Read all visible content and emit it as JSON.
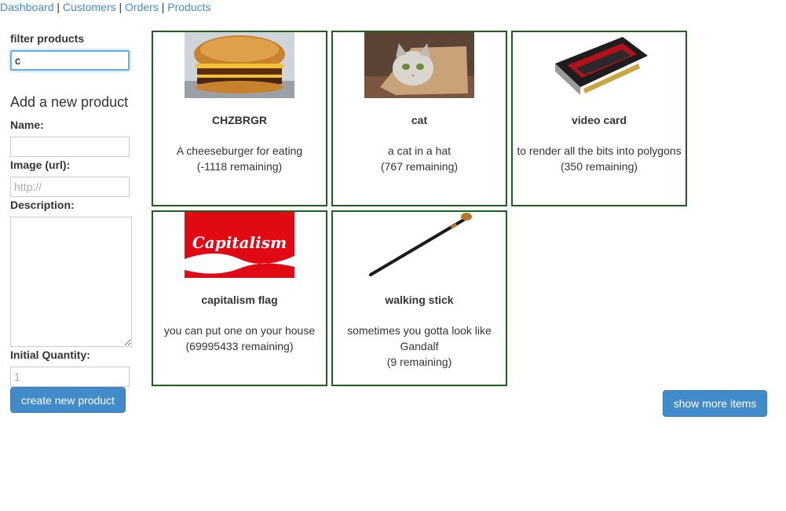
{
  "nav": {
    "links": [
      "Dashboard",
      "Customers",
      "Orders",
      "Products"
    ],
    "separator": "|"
  },
  "filter": {
    "label": "filter products",
    "value": "c"
  },
  "add_form": {
    "heading": "Add a new product",
    "name_label": "Name:",
    "name_value": "",
    "image_label": "Image (url):",
    "image_placeholder": "http://",
    "description_label": "Description:",
    "quantity_label": "Initial Quantity:",
    "quantity_placeholder": "1",
    "submit_label": "create new product"
  },
  "products": [
    {
      "name": "CHZBRGR",
      "description": "A cheeseburger for eating",
      "remaining": "(-1118 remaining)",
      "image": "cheeseburger-photo"
    },
    {
      "name": "cat",
      "description": "a cat in a hat",
      "remaining": "(767 remaining)",
      "image": "cat-photo"
    },
    {
      "name": "video card",
      "description": "to render all the bits into polygons",
      "remaining": "(350 remaining)",
      "image": "video-card-photo"
    },
    {
      "name": "capitalism flag",
      "description": "you can put one on your house",
      "remaining": "(69995433 remaining)",
      "image": "capitalism-flag-image",
      "image_text": "Capitalism"
    },
    {
      "name": "walking stick",
      "description": "sometimes you gotta look like Gandalf",
      "remaining": "(9 remaining)",
      "image": "walking-stick-photo"
    }
  ],
  "show_more_label": "show more items",
  "colors": {
    "link": "#428bca",
    "button": "#428bca",
    "card_border": "#1f5f1f",
    "flag_red": "#e10a14"
  }
}
